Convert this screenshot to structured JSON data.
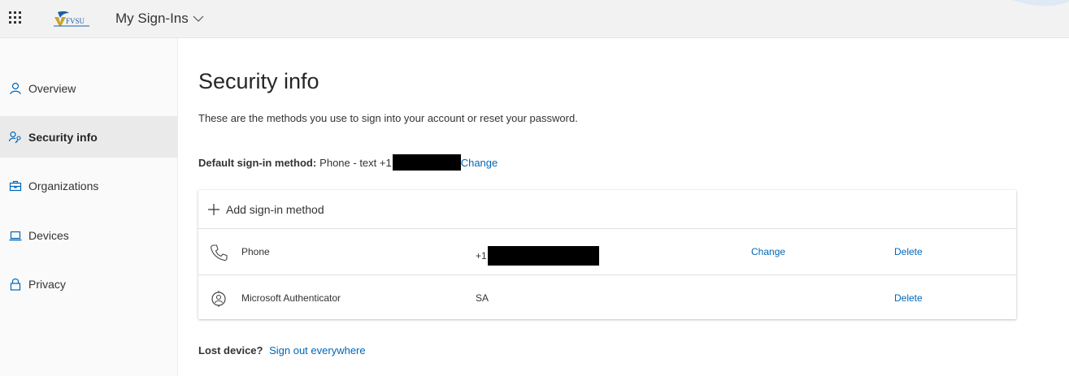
{
  "header": {
    "app_title": "My Sign-Ins",
    "logo_text": "FVSU",
    "icons": {
      "waffle": "app-launcher-icon",
      "dropdown": "chevron-down-icon"
    }
  },
  "sidebar": {
    "items": [
      {
        "label": "Overview",
        "icon": "person-icon",
        "active": false
      },
      {
        "label": "Security info",
        "icon": "key-person-icon",
        "active": true
      },
      {
        "label": "Organizations",
        "icon": "briefcase-icon",
        "active": false
      },
      {
        "label": "Devices",
        "icon": "laptop-icon",
        "active": false
      },
      {
        "label": "Privacy",
        "icon": "lock-icon",
        "active": false
      }
    ]
  },
  "main": {
    "title": "Security info",
    "subtitle": "These are the methods you use to sign into your account or reset your password.",
    "default_method": {
      "label": "Default sign-in method:",
      "value": "Phone - text +1",
      "change_label": "Change"
    },
    "add_method_label": "Add sign-in method",
    "methods": [
      {
        "name": "Phone",
        "detail": "+1",
        "change_label": "Change",
        "delete_label": "Delete",
        "icon": "phone-icon"
      },
      {
        "name": "Microsoft Authenticator",
        "detail": "SA",
        "change_label": "",
        "delete_label": "Delete",
        "icon": "authenticator-icon"
      }
    ],
    "lost_device": {
      "label": "Lost device?",
      "link": "Sign out everywhere"
    }
  },
  "colors": {
    "accent": "#0067b8",
    "sidebar_bg": "#fafafa",
    "active_bg": "#eaeaea",
    "topbar_bg": "#f2f2f2"
  }
}
